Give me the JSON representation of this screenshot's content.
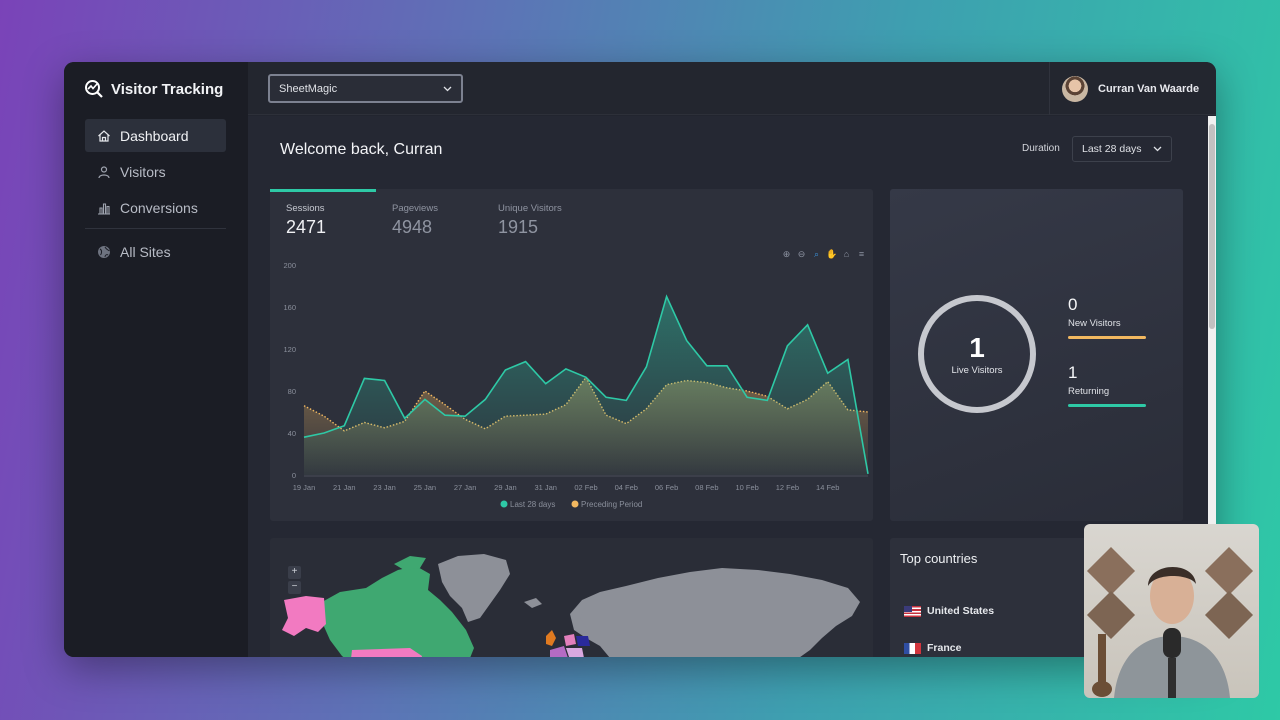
{
  "brand": {
    "title": "Visitor Tracking"
  },
  "sidebar": {
    "items": [
      {
        "label": "Dashboard",
        "icon": "home-icon",
        "active": true
      },
      {
        "label": "Visitors",
        "icon": "user-icon",
        "active": false
      },
      {
        "label": "Conversions",
        "icon": "bar-chart-icon",
        "active": false
      },
      {
        "label": "All Sites",
        "icon": "globe-icon",
        "active": false
      }
    ]
  },
  "header": {
    "site_select": {
      "value": "SheetMagic"
    },
    "user": {
      "name": "Curran Van Waarde"
    }
  },
  "main": {
    "welcome": "Welcome back, Curran",
    "duration": {
      "label": "Duration",
      "value": "Last 28 days"
    }
  },
  "metrics": {
    "tabs": [
      {
        "label": "Sessions",
        "value": "2471",
        "active": true
      },
      {
        "label": "Pageviews",
        "value": "4948",
        "active": false
      },
      {
        "label": "Unique Visitors",
        "value": "1915",
        "active": false
      }
    ]
  },
  "chart_data": {
    "type": "area",
    "x": [
      "19 Jan",
      "20 Jan",
      "21 Jan",
      "22 Jan",
      "23 Jan",
      "24 Jan",
      "25 Jan",
      "26 Jan",
      "27 Jan",
      "28 Jan",
      "29 Jan",
      "30 Jan",
      "31 Jan",
      "01 Feb",
      "02 Feb",
      "03 Feb",
      "04 Feb",
      "05 Feb",
      "06 Feb",
      "07 Feb",
      "08 Feb",
      "09 Feb",
      "10 Feb",
      "11 Feb",
      "12 Feb",
      "13 Feb",
      "14 Feb",
      "15 Feb",
      "16 Feb"
    ],
    "x_tick_labels": [
      "19 Jan",
      "21 Jan",
      "23 Jan",
      "25 Jan",
      "27 Jan",
      "29 Jan",
      "31 Jan",
      "02 Feb",
      "04 Feb",
      "06 Feb",
      "08 Feb",
      "10 Feb",
      "12 Feb",
      "14 Feb"
    ],
    "y_ticks": [
      0,
      40,
      80,
      120,
      160,
      200
    ],
    "ylim": [
      0,
      200
    ],
    "series": [
      {
        "name": "Last 28 days",
        "color": "#2ec9a6",
        "values": [
          36,
          40,
          47,
          92,
          90,
          54,
          72,
          57,
          56,
          72,
          100,
          108,
          87,
          101,
          93,
          74,
          71,
          103,
          170,
          128,
          104,
          104,
          74,
          71,
          123,
          143,
          97,
          110,
          1
        ]
      },
      {
        "name": "Preceding Period",
        "color": "#f2b860",
        "values": [
          66,
          56,
          42,
          50,
          45,
          51,
          80,
          67,
          53,
          44,
          56,
          57,
          58,
          67,
          93,
          57,
          49,
          63,
          86,
          90,
          88,
          83,
          80,
          75,
          63,
          72,
          89,
          62,
          60
        ]
      }
    ],
    "grid": false,
    "legend_position": "bottom"
  },
  "live": {
    "count": "1",
    "label": "Live Visitors",
    "new": {
      "value": "0",
      "label": "New Visitors",
      "color": "#f2b860"
    },
    "returning": {
      "value": "1",
      "label": "Returning",
      "color": "#2ec9a6"
    }
  },
  "map": {
    "zoom_in": "+",
    "zoom_out": "−"
  },
  "countries": {
    "title": "Top countries",
    "items": [
      {
        "name": "United States",
        "flag": "us-flag-icon"
      },
      {
        "name": "France",
        "flag": "fr-flag-icon"
      }
    ]
  }
}
